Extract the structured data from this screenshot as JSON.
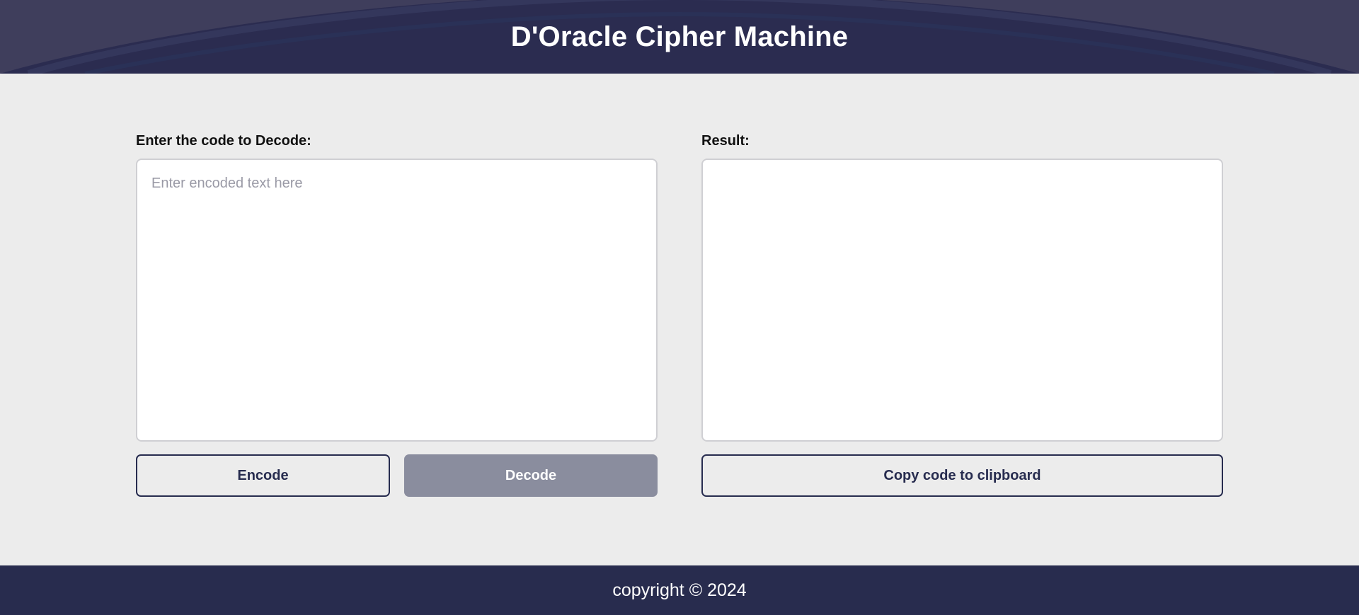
{
  "header": {
    "title": "D'Oracle Cipher Machine"
  },
  "input_panel": {
    "label": "Enter the code to Decode:",
    "value": "",
    "placeholder": "Enter encoded text here"
  },
  "result_panel": {
    "label": "Result:",
    "value": ""
  },
  "buttons": {
    "encode_label": "Encode",
    "decode_label": "Decode",
    "copy_label": "Copy code to clipboard"
  },
  "footer": {
    "text": "copyright © 2024"
  },
  "colors": {
    "header_bg": "#3f3e5c",
    "footer_bg": "#282c4e",
    "page_bg": "#ececec",
    "button_border": "#272c4f",
    "disabled_button_bg": "#8a8d9e"
  }
}
